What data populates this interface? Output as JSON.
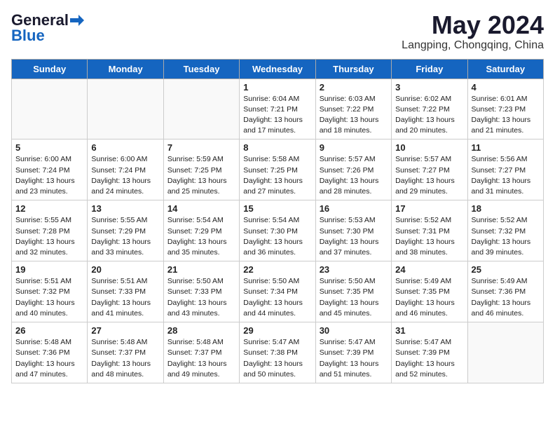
{
  "header": {
    "logo_line1": "General",
    "logo_line2": "Blue",
    "month_year": "May 2024",
    "location": "Langping, Chongqing, China"
  },
  "days_of_week": [
    "Sunday",
    "Monday",
    "Tuesday",
    "Wednesday",
    "Thursday",
    "Friday",
    "Saturday"
  ],
  "weeks": [
    [
      {
        "day": "",
        "info": ""
      },
      {
        "day": "",
        "info": ""
      },
      {
        "day": "",
        "info": ""
      },
      {
        "day": "1",
        "info": "Sunrise: 6:04 AM\nSunset: 7:21 PM\nDaylight: 13 hours\nand 17 minutes."
      },
      {
        "day": "2",
        "info": "Sunrise: 6:03 AM\nSunset: 7:22 PM\nDaylight: 13 hours\nand 18 minutes."
      },
      {
        "day": "3",
        "info": "Sunrise: 6:02 AM\nSunset: 7:22 PM\nDaylight: 13 hours\nand 20 minutes."
      },
      {
        "day": "4",
        "info": "Sunrise: 6:01 AM\nSunset: 7:23 PM\nDaylight: 13 hours\nand 21 minutes."
      }
    ],
    [
      {
        "day": "5",
        "info": "Sunrise: 6:00 AM\nSunset: 7:24 PM\nDaylight: 13 hours\nand 23 minutes."
      },
      {
        "day": "6",
        "info": "Sunrise: 6:00 AM\nSunset: 7:24 PM\nDaylight: 13 hours\nand 24 minutes."
      },
      {
        "day": "7",
        "info": "Sunrise: 5:59 AM\nSunset: 7:25 PM\nDaylight: 13 hours\nand 25 minutes."
      },
      {
        "day": "8",
        "info": "Sunrise: 5:58 AM\nSunset: 7:25 PM\nDaylight: 13 hours\nand 27 minutes."
      },
      {
        "day": "9",
        "info": "Sunrise: 5:57 AM\nSunset: 7:26 PM\nDaylight: 13 hours\nand 28 minutes."
      },
      {
        "day": "10",
        "info": "Sunrise: 5:57 AM\nSunset: 7:27 PM\nDaylight: 13 hours\nand 29 minutes."
      },
      {
        "day": "11",
        "info": "Sunrise: 5:56 AM\nSunset: 7:27 PM\nDaylight: 13 hours\nand 31 minutes."
      }
    ],
    [
      {
        "day": "12",
        "info": "Sunrise: 5:55 AM\nSunset: 7:28 PM\nDaylight: 13 hours\nand 32 minutes."
      },
      {
        "day": "13",
        "info": "Sunrise: 5:55 AM\nSunset: 7:29 PM\nDaylight: 13 hours\nand 33 minutes."
      },
      {
        "day": "14",
        "info": "Sunrise: 5:54 AM\nSunset: 7:29 PM\nDaylight: 13 hours\nand 35 minutes."
      },
      {
        "day": "15",
        "info": "Sunrise: 5:54 AM\nSunset: 7:30 PM\nDaylight: 13 hours\nand 36 minutes."
      },
      {
        "day": "16",
        "info": "Sunrise: 5:53 AM\nSunset: 7:30 PM\nDaylight: 13 hours\nand 37 minutes."
      },
      {
        "day": "17",
        "info": "Sunrise: 5:52 AM\nSunset: 7:31 PM\nDaylight: 13 hours\nand 38 minutes."
      },
      {
        "day": "18",
        "info": "Sunrise: 5:52 AM\nSunset: 7:32 PM\nDaylight: 13 hours\nand 39 minutes."
      }
    ],
    [
      {
        "day": "19",
        "info": "Sunrise: 5:51 AM\nSunset: 7:32 PM\nDaylight: 13 hours\nand 40 minutes."
      },
      {
        "day": "20",
        "info": "Sunrise: 5:51 AM\nSunset: 7:33 PM\nDaylight: 13 hours\nand 41 minutes."
      },
      {
        "day": "21",
        "info": "Sunrise: 5:50 AM\nSunset: 7:33 PM\nDaylight: 13 hours\nand 43 minutes."
      },
      {
        "day": "22",
        "info": "Sunrise: 5:50 AM\nSunset: 7:34 PM\nDaylight: 13 hours\nand 44 minutes."
      },
      {
        "day": "23",
        "info": "Sunrise: 5:50 AM\nSunset: 7:35 PM\nDaylight: 13 hours\nand 45 minutes."
      },
      {
        "day": "24",
        "info": "Sunrise: 5:49 AM\nSunset: 7:35 PM\nDaylight: 13 hours\nand 46 minutes."
      },
      {
        "day": "25",
        "info": "Sunrise: 5:49 AM\nSunset: 7:36 PM\nDaylight: 13 hours\nand 46 minutes."
      }
    ],
    [
      {
        "day": "26",
        "info": "Sunrise: 5:48 AM\nSunset: 7:36 PM\nDaylight: 13 hours\nand 47 minutes."
      },
      {
        "day": "27",
        "info": "Sunrise: 5:48 AM\nSunset: 7:37 PM\nDaylight: 13 hours\nand 48 minutes."
      },
      {
        "day": "28",
        "info": "Sunrise: 5:48 AM\nSunset: 7:37 PM\nDaylight: 13 hours\nand 49 minutes."
      },
      {
        "day": "29",
        "info": "Sunrise: 5:47 AM\nSunset: 7:38 PM\nDaylight: 13 hours\nand 50 minutes."
      },
      {
        "day": "30",
        "info": "Sunrise: 5:47 AM\nSunset: 7:39 PM\nDaylight: 13 hours\nand 51 minutes."
      },
      {
        "day": "31",
        "info": "Sunrise: 5:47 AM\nSunset: 7:39 PM\nDaylight: 13 hours\nand 52 minutes."
      },
      {
        "day": "",
        "info": ""
      }
    ]
  ]
}
